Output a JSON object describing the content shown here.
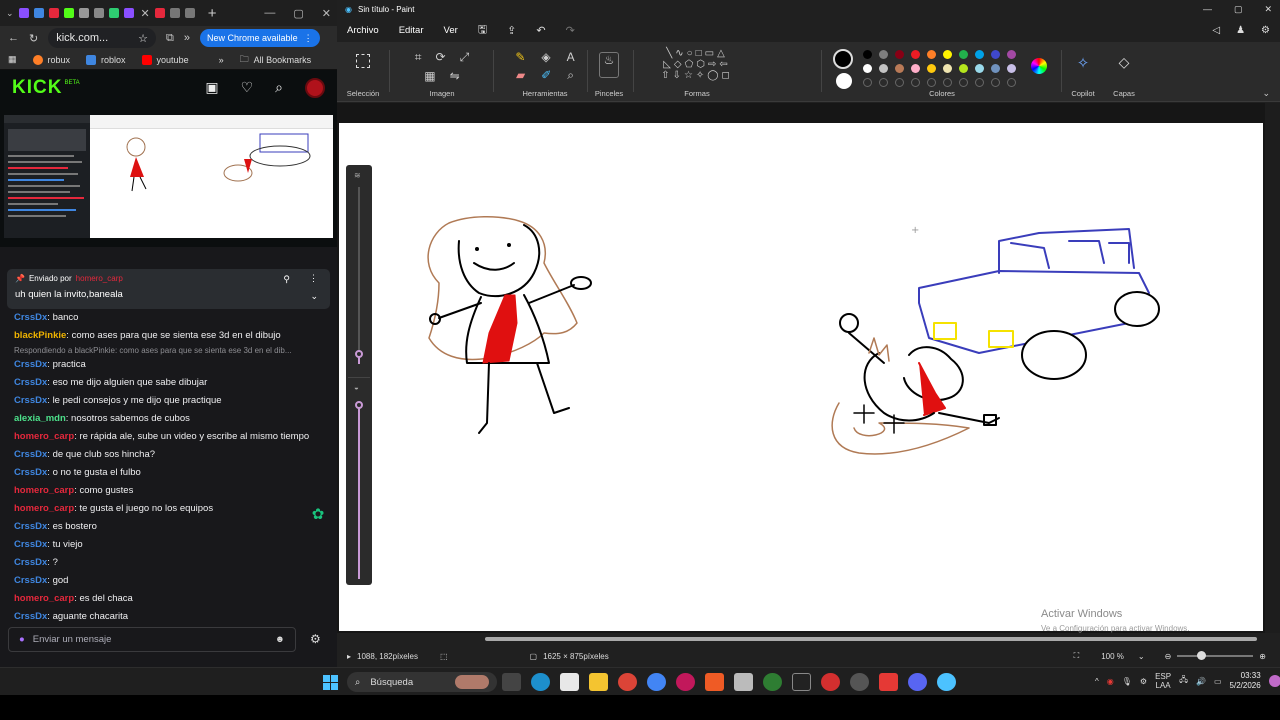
{
  "chrome": {
    "new_tab": "+",
    "url": "kick.com...",
    "update_label": "New Chrome available",
    "bookmarks": [
      "robux",
      "roblox",
      "youtube"
    ],
    "all_bookmarks": "All Bookmarks"
  },
  "kick": {
    "logo": "KICK",
    "beta": "BETA",
    "pinned": {
      "prefix": "Enviado por",
      "author": "homero_carp",
      "message": "uh quien la invito,baneala"
    },
    "chat": [
      {
        "user": "CrssDx",
        "color": "#3f86e0",
        "text": "banco"
      },
      {
        "user": "blackPinkie",
        "color": "#f0b400",
        "text": "como ases para que se sienta ese 3d en el dibujo"
      },
      {
        "reply": "Respondiendo a blackPinkie: como ases para que se sienta ese 3d en el dib..."
      },
      {
        "user": "CrssDx",
        "color": "#3f86e0",
        "text": "practica"
      },
      {
        "user": "CrssDx",
        "color": "#3f86e0",
        "text": "eso me dijo alguien que sabe dibujar"
      },
      {
        "user": "CrssDx",
        "color": "#3f86e0",
        "text": "le pedi consejos y me dijo que practique"
      },
      {
        "user": "alexia_mdn",
        "color": "#4ce08a",
        "text": "nosotros sabemos de cubos"
      },
      {
        "user": "homero_carp",
        "color": "#e5283c",
        "text": "re rápida ale, sube un video y escribe al mismo tiempo"
      },
      {
        "user": "CrssDx",
        "color": "#3f86e0",
        "text": "de que club sos hincha?"
      },
      {
        "user": "CrssDx",
        "color": "#3f86e0",
        "text": "o no te gusta el fulbo"
      },
      {
        "user": "homero_carp",
        "color": "#e5283c",
        "text": "como gustes"
      },
      {
        "user": "homero_carp",
        "color": "#e5283c",
        "text": "te gusta el juego no los equipos"
      },
      {
        "user": "CrssDx",
        "color": "#3f86e0",
        "text": "es bostero"
      },
      {
        "user": "CrssDx",
        "color": "#3f86e0",
        "text": "tu viejo"
      },
      {
        "user": "CrssDx",
        "color": "#3f86e0",
        "text": "?"
      },
      {
        "user": "CrssDx",
        "color": "#3f86e0",
        "text": "god"
      },
      {
        "user": "homero_carp",
        "color": "#e5283c",
        "text": "es del chaca"
      },
      {
        "user": "CrssDx",
        "color": "#3f86e0",
        "text": "aguante chacarita"
      }
    ],
    "input_placeholder": "Enviar un mensaje"
  },
  "paint": {
    "title": "Sin título - Paint",
    "menu": [
      "Archivo",
      "Editar",
      "Ver"
    ],
    "groups": [
      "Selección",
      "Imagen",
      "Herramientas",
      "Pinceles",
      "Formas",
      "Colores",
      "Copilot",
      "Capas"
    ],
    "palette": [
      "#000000",
      "#7f7f7f",
      "#880015",
      "#ed1c24",
      "#ff7f27",
      "#fff200",
      "#22b14c",
      "#00a2e8",
      "#3f48cc",
      "#a349a4",
      "#ffffff",
      "#c3c3c3",
      "#b97a57",
      "#ffaec9",
      "#ffc90e",
      "#efe4b0",
      "#b5e61d",
      "#99d9ea",
      "#7092be",
      "#c8bfe7"
    ],
    "status": {
      "cursor": "1088, 182píxeles",
      "size": "1625 × 875píxeles",
      "zoom": "100 %"
    },
    "watermark_title": "Activar Windows",
    "watermark_sub": "Ve a Configuración para activar Windows."
  },
  "taskbar": {
    "search": "Búsqueda",
    "lang1": "ESP",
    "lang2": "LAA",
    "time": "03:33",
    "date": "5/2/2026"
  }
}
